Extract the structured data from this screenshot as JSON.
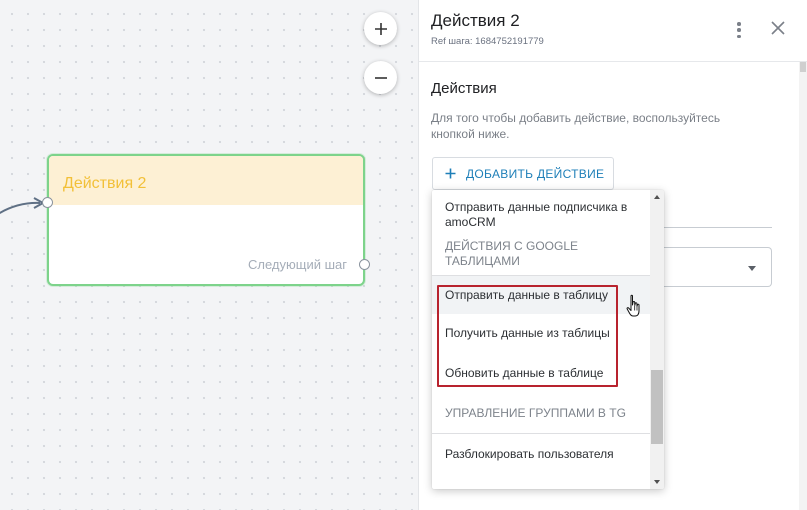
{
  "canvas": {
    "zoom_in_icon": "plus-icon",
    "zoom_out_icon": "minus-icon",
    "node": {
      "title": "Действия 2",
      "next_step_label": "Следующий шаг",
      "border_color": "#7dd38b",
      "header_color": "#fdf0d4",
      "title_color": "#f2c038"
    }
  },
  "panel": {
    "title": "Действия 2",
    "ref_label": "Ref шага: 1684752191779",
    "menu_icon": "more-vertical-icon",
    "close_icon": "close-icon",
    "section_title": "Действия",
    "section_description": "Для того чтобы добавить действие, воспользуйтесь кнопкой ниже.",
    "add_button_label": "ДОБАВИТЬ ДЕЙСТВИЕ",
    "accent_color": "#1e7fb8"
  },
  "dropdown": {
    "items": [
      {
        "type": "item",
        "label": "Отправить данные подписчика в amoCRM"
      },
      {
        "type": "group",
        "label": "ДЕЙСТВИЯ С GOOGLE ТАБЛИЦАМИ"
      },
      {
        "type": "item",
        "label": "Отправить данные в таблицу",
        "hovered": true
      },
      {
        "type": "item",
        "label": "Получить данные из таблицы"
      },
      {
        "type": "item",
        "label": "Обновить данные в таблице"
      },
      {
        "type": "group",
        "label": "УПРАВЛЕНИЕ ГРУППАМИ В TG"
      },
      {
        "type": "item",
        "label": "Разблокировать пользователя"
      }
    ],
    "highlight_color": "#b8232e"
  }
}
